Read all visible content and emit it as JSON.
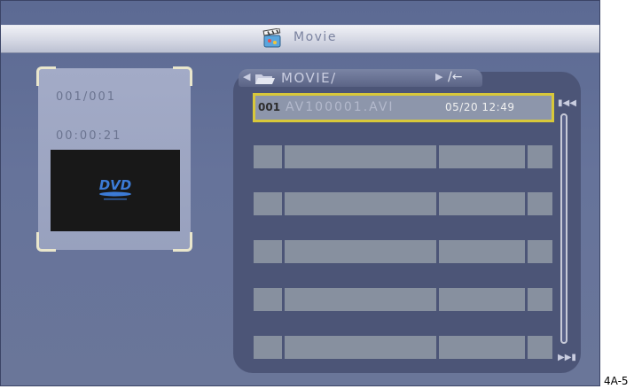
{
  "header": {
    "title": "Movie",
    "icon": "movie-clapper-icon"
  },
  "info": {
    "file_count": "001/001",
    "duration": "00:00:21",
    "thumbnail_logo": "DVD"
  },
  "browser": {
    "path": "MOVIE/",
    "selected_file": {
      "index": "001",
      "name": "AV100001.AVI",
      "datetime": "05/20 12:49"
    },
    "empty_rows": 5
  },
  "colors": {
    "selection_border": "#d8c83a",
    "screen_bg": "#66739a"
  },
  "caption": "4A-5"
}
